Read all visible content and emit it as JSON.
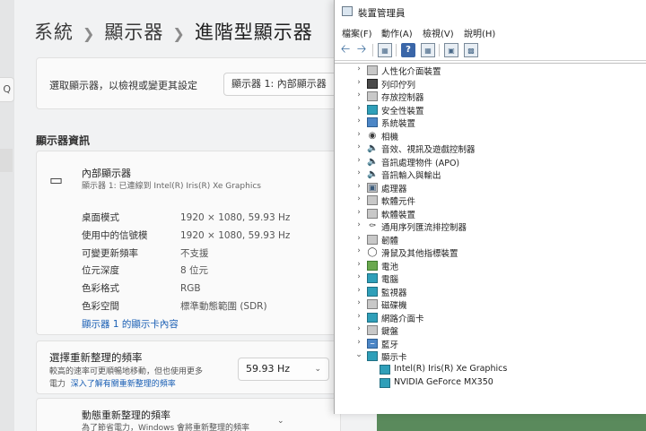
{
  "settings": {
    "breadcrumb": [
      "系統",
      "顯示器",
      "進階型顯示器"
    ],
    "search_icon_glyph": "Q",
    "select_display": {
      "label": "選取顯示器，以檢視或變更其設定",
      "value": "顯示器 1: 內部顯示器"
    },
    "section_title": "顯示器資訊",
    "display_info": {
      "name": "內部顯示器",
      "subtitle": "顯示器 1: 已連線到 Intel(R) Iris(R) Xe Graphics",
      "rows": [
        {
          "key": "桌面模式",
          "value": "1920 × 1080, 59.93 Hz"
        },
        {
          "key": "使用中的信號模",
          "value": "1920 × 1080, 59.93 Hz"
        },
        {
          "key": "可變更新頻率",
          "value": "不支援"
        },
        {
          "key": "位元深度",
          "value": "8 位元"
        },
        {
          "key": "色彩格式",
          "value": "RGB"
        },
        {
          "key": "色彩空間",
          "value": "標準動態範圍 (SDR)"
        }
      ],
      "adapter_link": "顯示器 1 的顯示卡內容"
    },
    "refresh_rate": {
      "title": "選擇重新整理的頻率",
      "desc": "較高的速率可更順暢地移動，但也使用更多",
      "desc_line2_prefix": "電力",
      "desc_link": "深入了解有關重新整理的頻率",
      "value": "59.93 Hz"
    },
    "dynamic_refresh": {
      "title": "動態重新整理的頻率",
      "desc": "為了節省電力，Windows 會將重新整理的頻率"
    }
  },
  "device_manager": {
    "title": "裝置管理員",
    "menu": [
      "檔案(F)",
      "動作(A)",
      "檢視(V)",
      "說明(H)"
    ],
    "tree": [
      {
        "label": "人性化介面裝置",
        "icon": "hid-icon",
        "expanded": false
      },
      {
        "label": "列印佇列",
        "icon": "printer-icon",
        "expanded": false
      },
      {
        "label": "存放控制器",
        "icon": "storage-controller-icon",
        "expanded": false
      },
      {
        "label": "安全性裝置",
        "icon": "security-device-icon",
        "expanded": false
      },
      {
        "label": "系統裝置",
        "icon": "system-device-icon",
        "expanded": false
      },
      {
        "label": "相機",
        "icon": "camera-icon",
        "expanded": false
      },
      {
        "label": "音效、視訊及遊戲控制器",
        "icon": "sound-icon",
        "expanded": false
      },
      {
        "label": "音訊處理物件 (APO)",
        "icon": "audio-apo-icon",
        "expanded": false
      },
      {
        "label": "音訊輸入與輸出",
        "icon": "audio-io-icon",
        "expanded": false
      },
      {
        "label": "處理器",
        "icon": "processor-icon",
        "expanded": false
      },
      {
        "label": "軟體元件",
        "icon": "software-component-icon",
        "expanded": false
      },
      {
        "label": "軟體裝置",
        "icon": "software-device-icon",
        "expanded": false
      },
      {
        "label": "通用序列匯流排控制器",
        "icon": "usb-icon",
        "expanded": false
      },
      {
        "label": "韌體",
        "icon": "firmware-icon",
        "expanded": false
      },
      {
        "label": "滑鼠及其他指標裝置",
        "icon": "mouse-icon",
        "expanded": false
      },
      {
        "label": "電池",
        "icon": "battery-icon",
        "expanded": false
      },
      {
        "label": "電腦",
        "icon": "computer-icon",
        "expanded": false
      },
      {
        "label": "監視器",
        "icon": "monitor-icon",
        "expanded": false
      },
      {
        "label": "磁碟機",
        "icon": "disk-drive-icon",
        "expanded": false
      },
      {
        "label": "網路介面卡",
        "icon": "network-adapter-icon",
        "expanded": false
      },
      {
        "label": "鍵盤",
        "icon": "keyboard-icon",
        "expanded": false
      },
      {
        "label": "藍牙",
        "icon": "bluetooth-icon",
        "expanded": false
      },
      {
        "label": "顯示卡",
        "icon": "display-adapter-icon",
        "expanded": true,
        "children": [
          "Intel(R) Iris(R) Xe Graphics",
          "NVIDIA GeForce MX350"
        ]
      }
    ]
  }
}
